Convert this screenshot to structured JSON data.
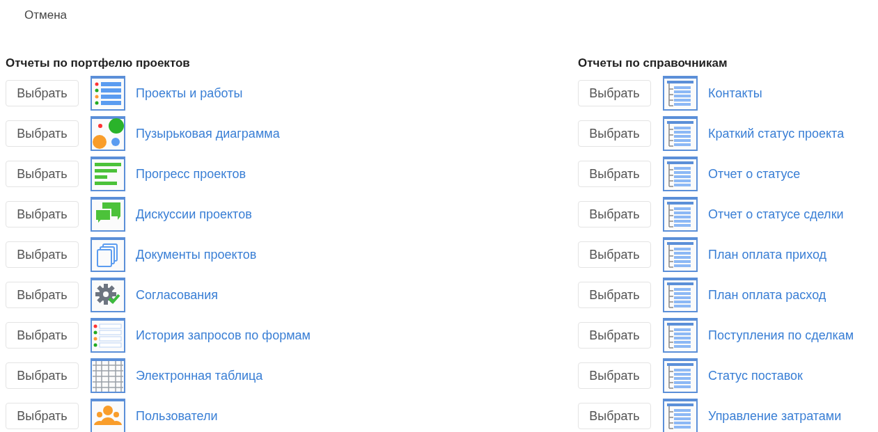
{
  "cancel": "Отмена",
  "sections": [
    {
      "title": "Отчеты по портфелю проектов",
      "items": [
        {
          "button": "Выбрать",
          "label": "Проекты и работы",
          "kind": "list"
        },
        {
          "button": "Выбрать",
          "label": "Пузырьковая диаграмма",
          "kind": "bubbles"
        },
        {
          "button": "Выбрать",
          "label": "Прогресс проектов",
          "kind": "progress"
        },
        {
          "button": "Выбрать",
          "label": "Дискуссии проектов",
          "kind": "chat"
        },
        {
          "button": "Выбрать",
          "label": "Документы проектов",
          "kind": "documents"
        },
        {
          "button": "Выбрать",
          "label": "Согласования",
          "kind": "approval"
        },
        {
          "button": "Выбрать",
          "label": "История запросов по формам",
          "kind": "history"
        },
        {
          "button": "Выбрать",
          "label": "Электронная таблица",
          "kind": "grid"
        },
        {
          "button": "Выбрать",
          "label": "Пользователи",
          "kind": "users"
        }
      ]
    },
    {
      "title": "Отчеты по справочникам",
      "items": [
        {
          "button": "Выбрать",
          "label": "Контакты",
          "kind": "tree"
        },
        {
          "button": "Выбрать",
          "label": "Краткий статус проекта",
          "kind": "tree"
        },
        {
          "button": "Выбрать",
          "label": "Отчет о статусе",
          "kind": "tree"
        },
        {
          "button": "Выбрать",
          "label": "Отчет о статусе сделки",
          "kind": "tree"
        },
        {
          "button": "Выбрать",
          "label": "План оплата приход",
          "kind": "tree"
        },
        {
          "button": "Выбрать",
          "label": "План оплата расход",
          "kind": "tree"
        },
        {
          "button": "Выбрать",
          "label": "Поступления по сделкам",
          "kind": "tree"
        },
        {
          "button": "Выбрать",
          "label": "Статус поставок",
          "kind": "tree"
        },
        {
          "button": "Выбрать",
          "label": "Управление затратами",
          "kind": "tree"
        }
      ]
    }
  ]
}
